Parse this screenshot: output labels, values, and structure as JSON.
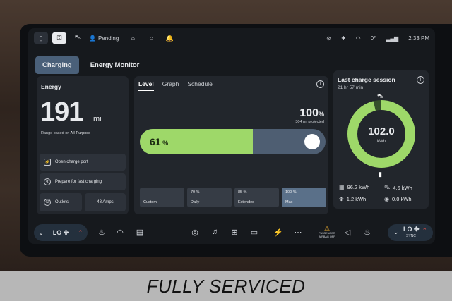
{
  "status": {
    "pending_label": "Pending",
    "temperature": "0°",
    "time": "2:33 PM"
  },
  "tabs": [
    "Charging",
    "Energy Monitor"
  ],
  "energy": {
    "label": "Energy",
    "value": "191",
    "unit": "mi",
    "range_prefix": "Range based on ",
    "range_mode": "All-Purpose",
    "buttons": {
      "open_charge_port": "Open charge port",
      "prepare_fast": "Prepare for fast charging",
      "outlets": "Outlets",
      "amps": "48 Amps"
    }
  },
  "level": {
    "subtabs": [
      "Level",
      "Graph",
      "Schedule"
    ],
    "target_pct": "100",
    "projected": "304 mi projected",
    "current_pct": "61",
    "current_fraction": 0.61,
    "presets": [
      {
        "pct": "--",
        "name": "Custom"
      },
      {
        "pct": "70 %",
        "name": "Daily"
      },
      {
        "pct": "85 %",
        "name": "Extended"
      },
      {
        "pct": "100 %",
        "name": "Max"
      }
    ]
  },
  "session": {
    "title": "Last charge session",
    "duration": "21 hr 57 min",
    "kwh_value": "102.0",
    "kwh_unit": "kWh",
    "ring_fraction": 0.96,
    "stats": {
      "drive": "96.2 kWh",
      "other": "4.6 kWh",
      "climate": "1.2 kWh",
      "misc": "0.0 kWh"
    }
  },
  "dock": {
    "left_climate": "LO",
    "right_climate": "LO",
    "sync": "SYNC",
    "airbag": [
      "PASSENGER",
      "AIRBAG OFF"
    ]
  },
  "banner": "FULLY SERVICED",
  "colors": {
    "accent_green": "#9ed869",
    "bar_track": "#4e5e72",
    "tab_active": "#4a6079",
    "heat_red": "#e0514a"
  }
}
